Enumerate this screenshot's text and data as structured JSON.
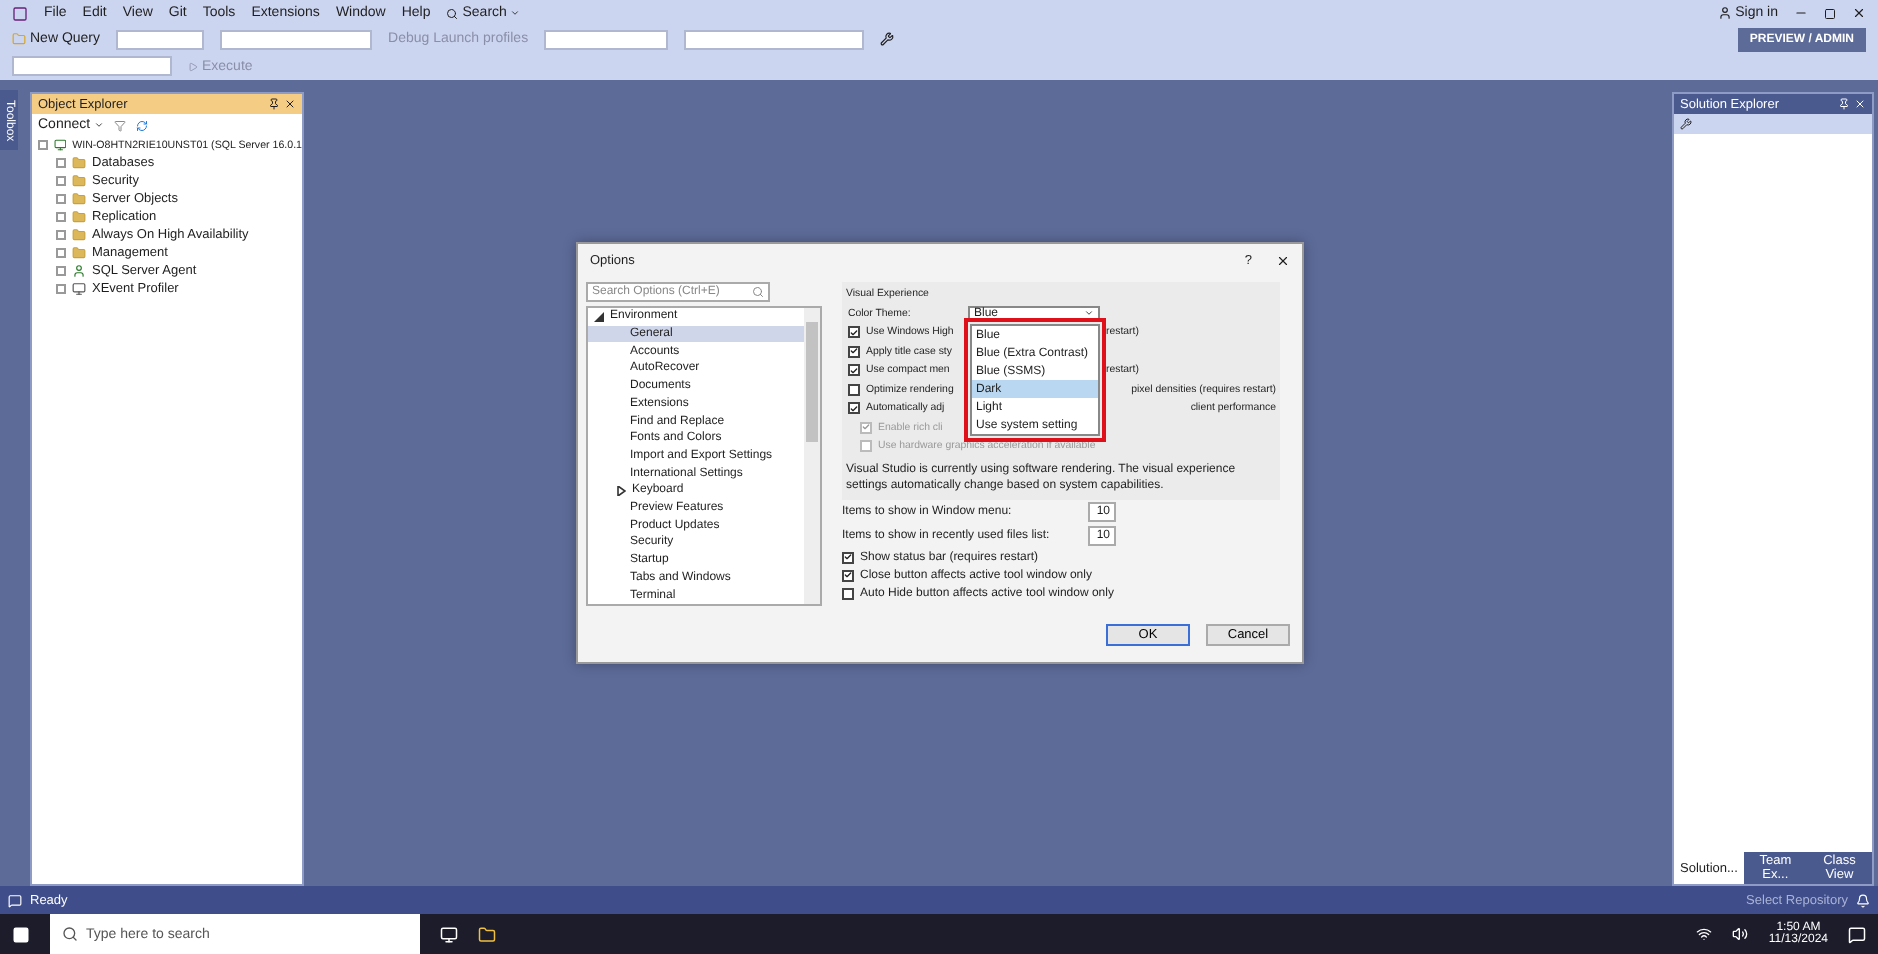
{
  "menu": {
    "items": [
      "File",
      "Edit",
      "View",
      "Git",
      "Tools",
      "Extensions",
      "Window",
      "Help"
    ],
    "search": "Search"
  },
  "toolbar": {
    "new_query": "New Query",
    "execute": "Execute",
    "debug_label": "Debug Launch profiles"
  },
  "account": {
    "sign_in": "Sign in",
    "badge": "PREVIEW / ADMIN"
  },
  "toolbox_tab": "Toolbox",
  "object_explorer": {
    "title": "Object Explorer",
    "connect": "Connect",
    "server": "WIN-O8HTN2RIE10UNST01 (SQL Server 16.0.1",
    "nodes": [
      {
        "label": "Databases",
        "kind": "folder"
      },
      {
        "label": "Security",
        "kind": "folder"
      },
      {
        "label": "Server Objects",
        "kind": "folder"
      },
      {
        "label": "Replication",
        "kind": "folder"
      },
      {
        "label": "Always On High Availability",
        "kind": "folder"
      },
      {
        "label": "Management",
        "kind": "folder"
      },
      {
        "label": "SQL Server Agent",
        "kind": "agent"
      },
      {
        "label": "XEvent Profiler",
        "kind": "profiler"
      }
    ]
  },
  "solution_explorer": {
    "title": "Solution Explorer",
    "tabs": [
      {
        "label": "Solution...",
        "selected": true
      },
      {
        "label": "Team Ex...",
        "selected": false
      },
      {
        "label": "Class View",
        "selected": false
      }
    ]
  },
  "dialog": {
    "title": "Options",
    "help": "?",
    "search_placeholder": "Search Options (Ctrl+E)",
    "tree": [
      {
        "label": "Environment",
        "expanded": true,
        "children": [
          {
            "label": "General",
            "selected": true
          },
          {
            "label": "Accounts",
            "selected": false
          },
          {
            "label": "AutoRecover",
            "selected": false
          },
          {
            "label": "Documents",
            "selected": false
          },
          {
            "label": "Extensions",
            "selected": false
          },
          {
            "label": "Find and Replace",
            "selected": false
          },
          {
            "label": "Fonts and Colors",
            "selected": false
          },
          {
            "label": "Import and Export Settings",
            "selected": false
          },
          {
            "label": "International Settings",
            "selected": false
          },
          {
            "label": "Keyboard",
            "selected": false,
            "expandable": true
          },
          {
            "label": "Preview Features",
            "selected": false
          },
          {
            "label": "Product Updates",
            "selected": false
          },
          {
            "label": "Security",
            "selected": false
          },
          {
            "label": "Startup",
            "selected": false
          },
          {
            "label": "Tabs and Windows",
            "selected": false
          },
          {
            "label": "Terminal",
            "selected": false
          }
        ]
      }
    ],
    "section": "Visual Experience",
    "theme_label": "Color Theme:",
    "theme_value": "Blue",
    "theme_options": [
      {
        "label": "Blue",
        "selected": false
      },
      {
        "label": "Blue (Extra Contrast)",
        "selected": false
      },
      {
        "label": "Blue (SSMS)",
        "selected": false
      },
      {
        "label": "Dark",
        "selected": true
      },
      {
        "label": "Light",
        "selected": false
      },
      {
        "label": "Use system setting",
        "selected": false
      }
    ],
    "visual_options": [
      {
        "text": "Use Windows High",
        "text_after": "restart)",
        "checked": true,
        "disabled": false,
        "sub": false
      },
      {
        "text": "Apply title case sty",
        "checked": true,
        "disabled": false,
        "sub": false
      },
      {
        "text": "Use compact men",
        "text_after": "restart)",
        "checked": true,
        "disabled": false,
        "sub": false
      },
      {
        "text": "Optimize rendering",
        "text_after": "pixel densities (requires restart)",
        "checked": false,
        "disabled": false,
        "sub": false
      },
      {
        "text": "Automatically adj",
        "text_after": "client performance",
        "checked": true,
        "disabled": false,
        "sub": false
      },
      {
        "text": "Enable rich cli",
        "checked": true,
        "disabled": true,
        "sub": true
      },
      {
        "text": "Use hardware graphics acceleration if available",
        "checked": false,
        "disabled": true,
        "sub": true
      }
    ],
    "info": "Visual Studio is currently using software rendering.  The visual experience settings automatically change based on system capabilities.",
    "numbers": [
      {
        "label": "Items to show in Window menu:",
        "value": "10"
      },
      {
        "label": "Items to show in recently used files list:",
        "value": "10"
      }
    ],
    "options": [
      {
        "text": "Show status bar (requires restart)",
        "checked": true
      },
      {
        "text": "Close button affects active tool window only",
        "checked": true
      },
      {
        "text": "Auto Hide button affects active tool window only",
        "checked": false
      }
    ],
    "buttons": [
      {
        "label": "OK",
        "default": true
      },
      {
        "label": "Cancel",
        "default": false
      }
    ]
  },
  "status_bar": {
    "text": "Ready",
    "repo": "Select Repository"
  },
  "taskbar": {
    "search_placeholder": "Type here to search",
    "time": "1:50 AM",
    "date": "11/13/2024"
  }
}
